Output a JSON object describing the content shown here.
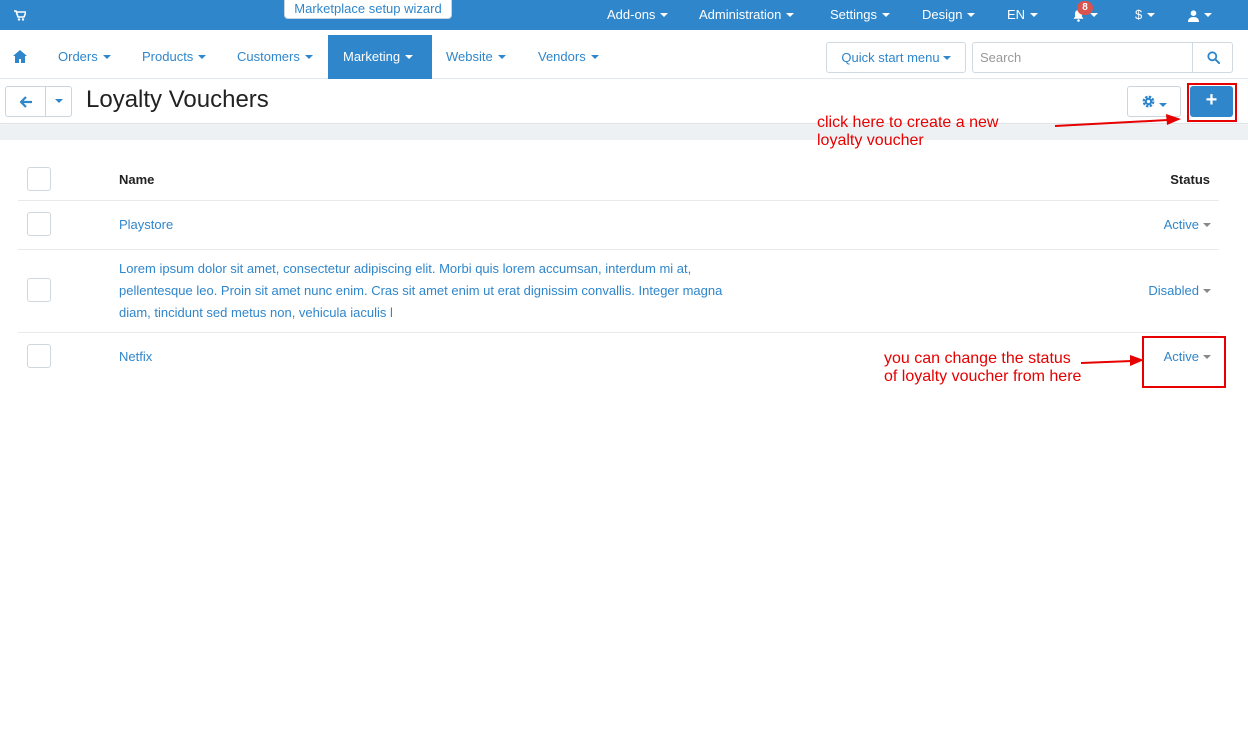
{
  "topbar": {
    "wizard_label": "Marketplace setup wizard",
    "items": [
      "Add-ons",
      "Administration",
      "Settings",
      "Design",
      "EN"
    ],
    "notification_count": "8",
    "currency": "$"
  },
  "mainnav": {
    "items": [
      "Orders",
      "Products",
      "Customers",
      "Marketing",
      "Website",
      "Vendors"
    ],
    "active": "Marketing",
    "quick_start": "Quick start menu",
    "search_placeholder": "Search"
  },
  "page": {
    "title": "Loyalty Vouchers"
  },
  "table": {
    "headers": {
      "name": "Name",
      "status": "Status"
    },
    "rows": [
      {
        "name": "Playstore",
        "status": "Active"
      },
      {
        "name": "Lorem ipsum dolor sit amet, consectetur adipiscing elit. Morbi quis lorem accumsan, interdum mi at, pellentesque leo. Proin sit amet nunc enim. Cras sit amet enim ut erat dignissim convallis. Integer magna diam, tincidunt sed metus non, vehicula iaculis l",
        "status": "Disabled"
      },
      {
        "name": "Netfix",
        "status": "Active"
      }
    ]
  },
  "annotations": {
    "create_line1": "click here to create a new",
    "create_line2": "loyalty voucher",
    "status_line1": "you can change the status",
    "status_line2": "of loyalty voucher from here"
  },
  "colors": {
    "primary": "#2f86cb",
    "annotation": "#e60000",
    "badge": "#d9534f"
  },
  "icons": [
    "cart-icon",
    "bell-icon",
    "user-icon",
    "home-icon",
    "search-icon",
    "arrow-left-icon",
    "gear-icon",
    "plus-icon"
  ]
}
